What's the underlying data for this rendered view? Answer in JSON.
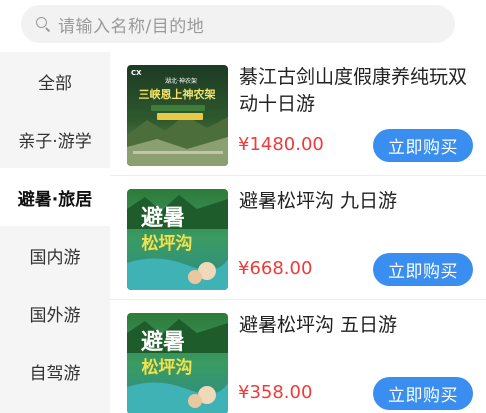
{
  "search": {
    "placeholder": "请输入名称/目的地",
    "icon": "search-icon"
  },
  "sidebar": {
    "items": [
      {
        "label": "全部",
        "active": false
      },
      {
        "label": "亲子·游学",
        "active": false
      },
      {
        "label": "避暑·旅居",
        "active": true
      },
      {
        "label": "国内游",
        "active": false
      },
      {
        "label": "国外游",
        "active": false
      },
      {
        "label": "自驾游",
        "active": false
      }
    ]
  },
  "products": [
    {
      "title": "綦江古剑山度假康养纯玩双动十日游",
      "price": "¥1480.00",
      "buy_label": "立即购买",
      "thumb": {
        "brand": "CX",
        "headline": "三峡恩上神农架",
        "sub": "湖北·神农架"
      }
    },
    {
      "title": "避暑松坪沟 九日游",
      "price": "¥668.00",
      "buy_label": "立即购买",
      "thumb": {
        "headline1": "避暑",
        "headline2": "松坪沟"
      }
    },
    {
      "title": "避暑松坪沟 五日游",
      "price": "¥358.00",
      "buy_label": "立即购买",
      "thumb": {
        "headline1": "避暑",
        "headline2": "松坪沟"
      }
    }
  ],
  "colors": {
    "accent": "#3a8ef0",
    "price": "#ee3b3b",
    "sidebar_bg": "#f5f5f5"
  }
}
